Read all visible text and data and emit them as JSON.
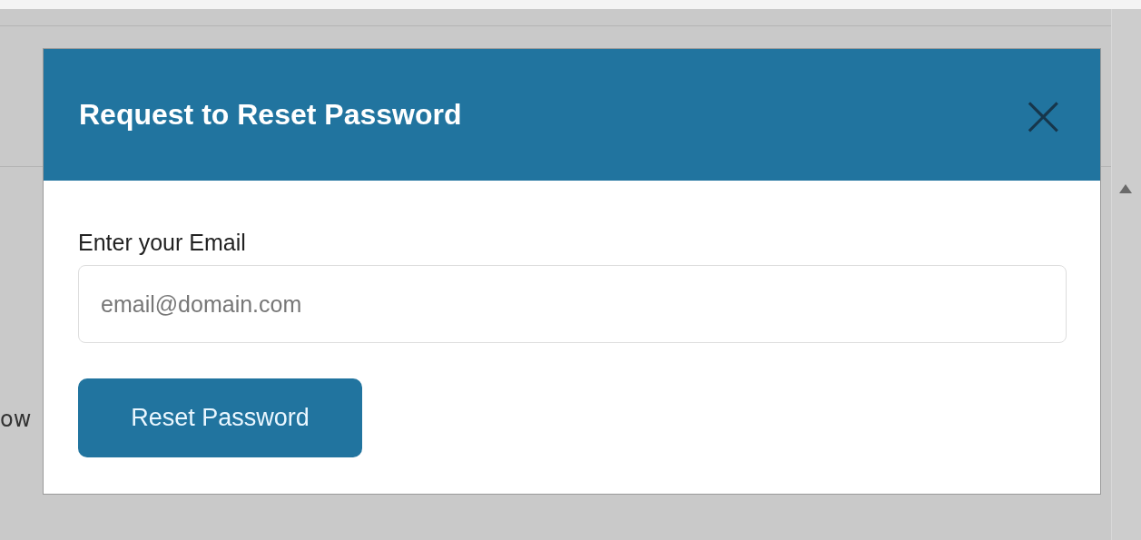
{
  "background": {
    "text_fragment": "ow"
  },
  "dialog": {
    "title": "Request to Reset Password",
    "close": "×",
    "field": {
      "label": "Enter your Email",
      "placeholder": "email@domain.com"
    },
    "button": "Reset Password"
  }
}
